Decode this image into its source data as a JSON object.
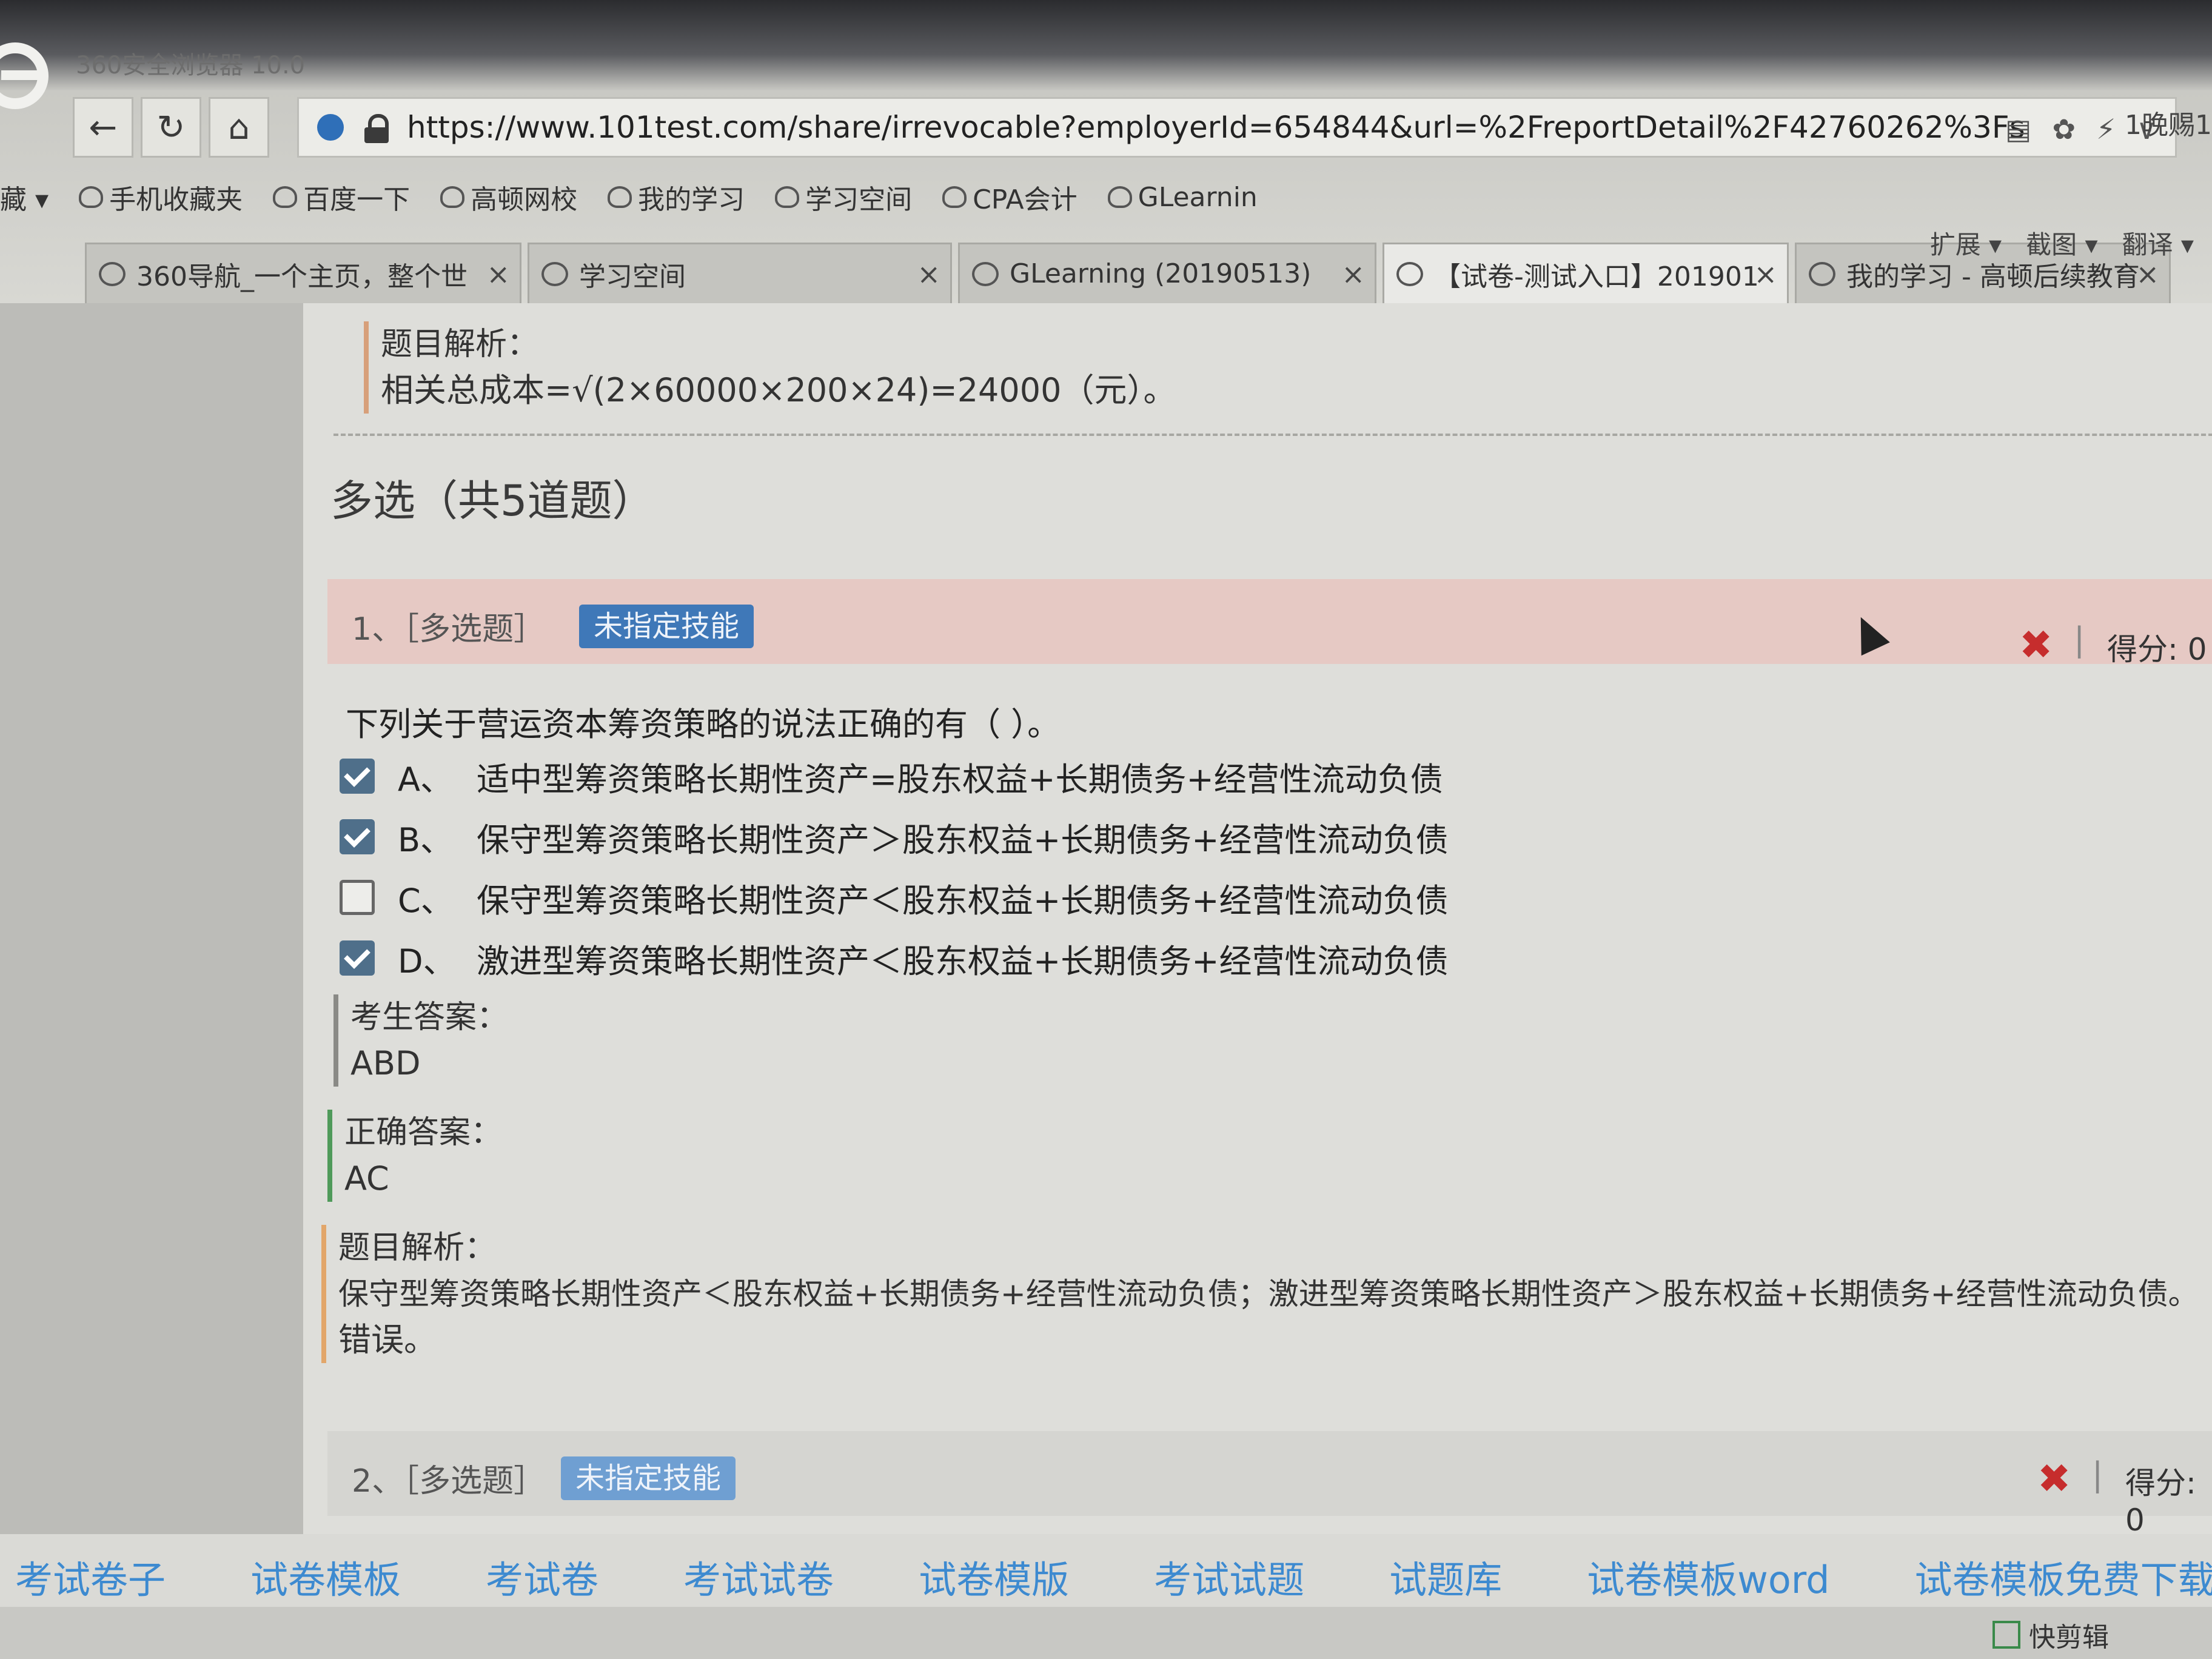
{
  "browser": {
    "app_title": "360安全浏览器 10.0",
    "url": "https://www.101test.com/share/irrevocable?employerId=654844&url=%2FreportDetail%2F42760262%3Fs",
    "side_label": "1晚赐1",
    "nav": {
      "back": "←",
      "refresh": "↻",
      "home": "⌂"
    },
    "tools": [
      "▤",
      "✿",
      "⚡",
      "∨"
    ]
  },
  "bookmarks": {
    "lead": "藏 ▾",
    "items": [
      "手机收藏夹",
      "百度一下",
      "高顿网校",
      "我的学习",
      "学习空间",
      "CPA会计",
      "GLearnin"
    ]
  },
  "tabs": [
    {
      "label": "360导航_一个主页，整个世",
      "close": "×"
    },
    {
      "label": "学习空间",
      "close": "×"
    },
    {
      "label": "GLearning (20190513)",
      "close": "×"
    },
    {
      "label": "【试卷-测试入口】201901",
      "close": "×"
    },
    {
      "label": "我的学习 - 高顿后续教育",
      "close": "×"
    }
  ],
  "tab_tools": {
    "extend": "扩展 ▾",
    "screenshot": "截图 ▾",
    "translate": "翻译 ▾"
  },
  "prev_analysis": {
    "label": "题目解析：",
    "text": "相关总成本=√(2×60000×200×24)=24000（元）。"
  },
  "section_title": "多选（共5道题）",
  "questions": [
    {
      "num": "1、［多选题］",
      "skill": "未指定技能",
      "mark": "✖",
      "sep": "|",
      "score": "得分: 0",
      "text": "下列关于营运资本筹资策略的说法正确的有（ ）。",
      "options": [
        {
          "letter": "A、",
          "text": "适中型筹资策略长期性资产=股东权益+长期债务+经营性流动负债",
          "checked": true
        },
        {
          "letter": "B、",
          "text": "保守型筹资策略长期性资产＞股东权益+长期债务+经营性流动负债",
          "checked": true
        },
        {
          "letter": "C、",
          "text": "保守型筹资策略长期性资产＜股东权益+长期债务+经营性流动负债",
          "checked": false
        },
        {
          "letter": "D、",
          "text": "激进型筹资策略长期性资产＜股东权益+长期债务+经营性流动负债",
          "checked": true
        }
      ],
      "student_answer_label": "考生答案：",
      "student_answer": "ABD",
      "correct_answer_label": "正确答案：",
      "correct_answer": "AC",
      "analysis_label": "题目解析：",
      "analysis_line1": "保守型筹资策略长期性资产＜股东权益+长期债务+经营性流动负债；激进型筹资策略长期性资产＞股东权益+长期债务+经营性流动负债。",
      "analysis_line2": "错误。"
    },
    {
      "num": "2、［多选题］",
      "skill": "未指定技能",
      "mark": "✖",
      "sep": "|",
      "score": "得分: 0"
    }
  ],
  "bottom_links": [
    "考试卷子",
    "试卷模板",
    "考试卷",
    "考试试卷",
    "试卷模版",
    "考试试题",
    "试题库",
    "试卷模板word",
    "试卷模板免费下载"
  ],
  "status": {
    "tool": "快剪辑"
  },
  "colors": {
    "skill_badge": "#3f78b8",
    "wrong_mark": "#c62d2d",
    "link": "#3d8ad0",
    "question_header": "#e6c9c4",
    "analysis_bar": "#e2a66a"
  }
}
